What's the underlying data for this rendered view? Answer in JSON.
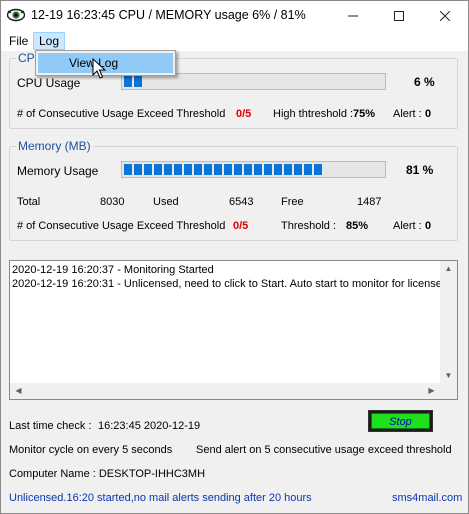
{
  "window": {
    "title": "12-19 16:23:45 CPU / MEMORY usage 6% / 81%",
    "app_icon": "eye-icon",
    "minimize_icon": "minimize-icon",
    "maximize_icon": "maximize-icon",
    "close_icon": "close-icon"
  },
  "menu": {
    "file": "File",
    "log": "Log",
    "log_items": [
      "View Log"
    ]
  },
  "cpu": {
    "legend": "CP",
    "usage_label": "CPU Usage",
    "usage_percent": "6 %",
    "usage_value": 0.06,
    "consecutive_label": "# of Consecutive Usage Exceed Threshold",
    "consecutive_value": "0/5",
    "threshold_label": "High thtreshold :",
    "threshold_value": "75%",
    "alert_label": "Alert :",
    "alert_value": "0"
  },
  "memory": {
    "legend": "Memory (MB)",
    "usage_label": "Memory Usage",
    "usage_percent": "81 %",
    "usage_value": 0.81,
    "total_label": "Total",
    "total_value": "8030",
    "used_label": "Used",
    "used_value": "6543",
    "free_label": "Free",
    "free_value": "1487",
    "consecutive_label": "# of Consecutive Usage Exceed Threshold",
    "consecutive_value": "0/5",
    "threshold_label": "Threshold :",
    "threshold_value": "85%",
    "alert_label": "Alert :",
    "alert_value": "0"
  },
  "log": {
    "lines": [
      "2020-12-19 16:20:37 - Monitoring Started",
      "2020-12-19 16:20:31 - Unlicensed, need to click to Start. Auto start to monitor for license"
    ]
  },
  "status": {
    "last_check_label": "Last time check :",
    "last_check_value": "16:23:45 2020-12-19",
    "stop_button": "Stop",
    "monitor_cycle": "Monitor cycle on every 5 seconds",
    "send_alert": "Send alert on 5 consecutive usage exceed threshold",
    "computer_name": "Computer Name : DESKTOP-IHHC3MH",
    "license_notice": "Unlicensed.16:20 started,no mail alerts sending after 20 hours",
    "website": "sms4mail.com"
  },
  "colors": {
    "progress": "#0a74da",
    "threshold_red": "#e00000",
    "legend_blue": "#1e50a0",
    "stop_green": "#1fe01f",
    "link_blue": "#0a36b0",
    "menu_highlight": "#91c9f7"
  }
}
